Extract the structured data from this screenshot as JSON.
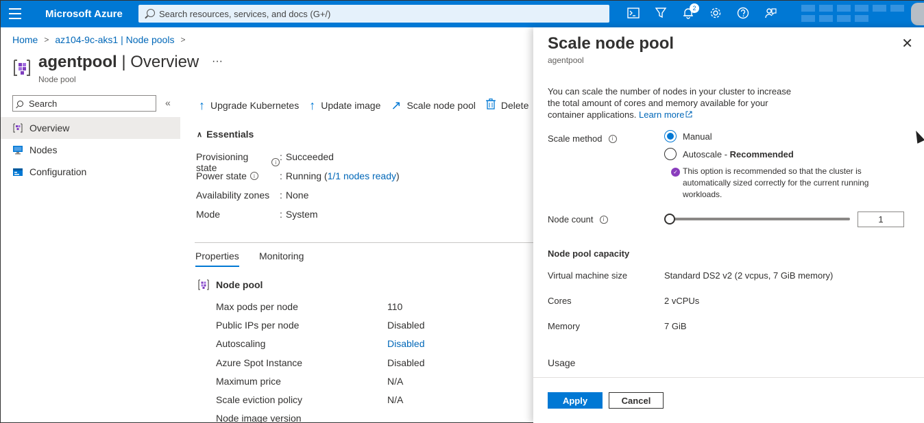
{
  "topbar": {
    "brand": "Microsoft Azure",
    "search_placeholder": "Search resources, services, and docs (G+/)",
    "notification_count": "2",
    "icons": [
      "cloud-shell-icon",
      "directory-filter-icon",
      "bell-icon",
      "gear-icon",
      "help-icon",
      "feedback-icon"
    ]
  },
  "breadcrumb": {
    "items": [
      "Home",
      "az104-9c-aks1 | Node pools"
    ]
  },
  "header": {
    "title_main": "agentpool",
    "title_rest": " | Overview",
    "subtitle": "Node pool",
    "more": "···"
  },
  "nav": {
    "search_placeholder": "Search",
    "collapse": "«",
    "items": [
      {
        "label": "Overview",
        "icon": "overview-icon"
      },
      {
        "label": "Nodes",
        "icon": "nodes-icon"
      },
      {
        "label": "Configuration",
        "icon": "configuration-icon"
      }
    ]
  },
  "toolbar": {
    "upgrade": "Upgrade Kubernetes",
    "update_image": "Update image",
    "scale": "Scale node pool",
    "delete": "Delete"
  },
  "essentials": {
    "heading": "Essentials",
    "rows": [
      {
        "label": "Provisioning state",
        "value": "Succeeded"
      },
      {
        "label": "Power state",
        "value": "Running (",
        "link": "1/1 nodes ready",
        "suffix": ")"
      },
      {
        "label": "Availability zones",
        "value": "None"
      },
      {
        "label": "Mode",
        "value": "System"
      }
    ]
  },
  "tabs": {
    "properties": "Properties",
    "monitoring": "Monitoring"
  },
  "node_pool": {
    "heading": "Node pool",
    "rows": [
      {
        "label": "Max pods per node",
        "value": "110"
      },
      {
        "label": "Public IPs per node",
        "value": "Disabled"
      },
      {
        "label": "Autoscaling",
        "value": "Disabled"
      },
      {
        "label": "Azure Spot Instance",
        "value": "Disabled"
      },
      {
        "label": "Maximum price",
        "value": "N/A"
      },
      {
        "label": "Scale eviction policy",
        "value": "N/A"
      },
      {
        "label": "Node image version",
        "value": ""
      }
    ]
  },
  "blade": {
    "title": "Scale node pool",
    "subtitle": "agentpool",
    "close": "✕",
    "description": "You can scale the number of nodes in your cluster to increase the total amount of cores and memory available for your container applications.",
    "learn_more": "Learn more",
    "scale_method_label": "Scale method",
    "manual": "Manual",
    "autoscale": "Autoscale",
    "autoscale_dash": " - ",
    "recommended": "Recommended",
    "rec_note": "This option is recommended so that the cluster is automatically sized correctly for the current running workloads.",
    "node_count_label": "Node count",
    "node_count": "1",
    "node_count_slider_fraction": 0,
    "capacity_heading": "Node pool capacity",
    "vm_size_label": "Virtual machine size",
    "vm_size": "Standard DS2 v2 (2 vcpus, 7 GiB memory)",
    "cores_label": "Cores",
    "cores": "2 vCPUs",
    "memory_label": "Memory",
    "memory": "7 GiB",
    "usage_label": "Usage",
    "apply": "Apply",
    "cancel": "Cancel"
  },
  "colors": {
    "accent": "#0078d4",
    "link": "#0067b8",
    "recommend": "#8a3dbd"
  }
}
